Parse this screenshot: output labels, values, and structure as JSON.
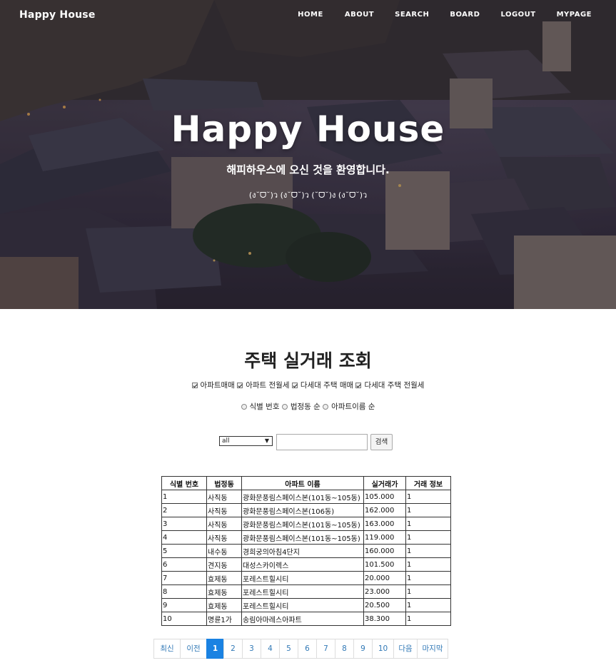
{
  "navbar": {
    "brand": "Happy House",
    "links": [
      "HOME",
      "ABOUT",
      "SEARCH",
      "BOARD",
      "LOGOUT",
      "MYPAGE"
    ]
  },
  "hero": {
    "title": "Happy House",
    "subtitle": "해피하우스에 오신 것을 환영합니다.",
    "emoticons": "(ง˘ᗜ˘)ว (ง˘ᗜ˘)ว (˘ᗜ˘)ง (ง˘ᗜ˘)ว"
  },
  "main": {
    "title": "주택 실거래 조회",
    "checkboxes": [
      {
        "label": "아파트매매",
        "checked": true
      },
      {
        "label": "아파트 전월세",
        "checked": true
      },
      {
        "label": "다세대 주택 매매",
        "checked": true
      },
      {
        "label": "다세대 주택 전월세",
        "checked": true
      }
    ],
    "sort_radios": [
      {
        "label": "식별 번호",
        "checked": false
      },
      {
        "label": "법정동 순",
        "checked": false
      },
      {
        "label": "아파트이름 순",
        "checked": false
      }
    ],
    "search": {
      "select_value": "all",
      "input_value": "",
      "button_label": "검색"
    }
  },
  "table": {
    "headers": [
      "식별 번호",
      "법정동",
      "아파트 이름",
      "실거래가",
      "거래 정보"
    ],
    "rows": [
      [
        "1",
        "사직동",
        "광화문풍림스페이스본(101동~105동)",
        "105.000",
        "1"
      ],
      [
        "2",
        "사직동",
        "광화문풍림스페이스본(106동)",
        "162.000",
        "1"
      ],
      [
        "3",
        "사직동",
        "광화문풍림스페이스본(101동~105동)",
        "163.000",
        "1"
      ],
      [
        "4",
        "사직동",
        "광화문풍림스페이스본(101동~105동)",
        "119.000",
        "1"
      ],
      [
        "5",
        "내수동",
        "경희궁의아침4단지",
        "160.000",
        "1"
      ],
      [
        "6",
        "견지동",
        "대성스카이렉스",
        "101.500",
        "1"
      ],
      [
        "7",
        "효제동",
        "포레스트힐시티",
        "20.000",
        "1"
      ],
      [
        "8",
        "효제동",
        "포레스트힐시티",
        "23.000",
        "1"
      ],
      [
        "9",
        "효제동",
        "포레스트힐시티",
        "20.500",
        "1"
      ],
      [
        "10",
        "명륜1가",
        "송림아마레스아파트",
        "38.300",
        "1"
      ]
    ]
  },
  "pagination": {
    "items": [
      "최신",
      "이전",
      "1",
      "2",
      "3",
      "4",
      "5",
      "6",
      "7",
      "8",
      "9",
      "10",
      "다음",
      "마지막"
    ],
    "active": "1"
  },
  "colors": {
    "accent": "#1a82e2",
    "link": "#337ab7"
  }
}
